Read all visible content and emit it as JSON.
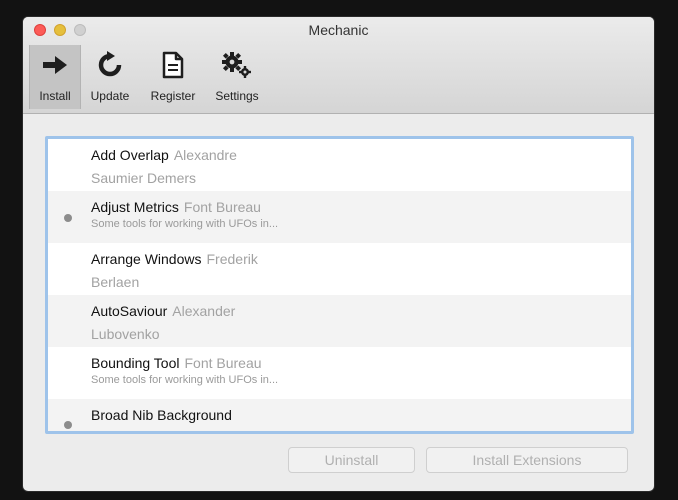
{
  "window": {
    "title": "Mechanic"
  },
  "toolbar": {
    "items": [
      {
        "label": "Install",
        "icon": "arrow-right-icon",
        "selected": true
      },
      {
        "label": "Update",
        "icon": "refresh-icon",
        "selected": false
      },
      {
        "label": "Register",
        "icon": "document-icon",
        "selected": false
      },
      {
        "label": "Settings",
        "icon": "gears-icon",
        "selected": false
      }
    ]
  },
  "extensions": [
    {
      "name": "Add Overlap",
      "author_line1": "Alexandre",
      "author_line2": "Saumier Demers",
      "description": "",
      "installed": false
    },
    {
      "name": "Adjust Metrics",
      "author_line1": "Font Bureau",
      "author_line2": "",
      "description": "Some tools for working with UFOs in...",
      "installed": true
    },
    {
      "name": "Arrange Windows",
      "author_line1": "Frederik",
      "author_line2": "Berlaen",
      "description": "",
      "installed": false
    },
    {
      "name": "AutoSaviour",
      "author_line1": "Alexander",
      "author_line2": "Lubovenko",
      "description": "",
      "installed": false
    },
    {
      "name": "Bounding Tool",
      "author_line1": "Font Bureau",
      "author_line2": "",
      "description": "Some tools for working with UFOs in...",
      "installed": false
    },
    {
      "name": "Broad Nib Background",
      "author_line1": "",
      "author_line2": "",
      "description": "",
      "installed": true
    }
  ],
  "buttons": {
    "uninstall": "Uninstall",
    "install_extensions": "Install Extensions"
  },
  "colors": {
    "selection_border": "#9ec3ea",
    "installed_dot": "#8c8c8c",
    "author_text": "#a2a2a2"
  }
}
